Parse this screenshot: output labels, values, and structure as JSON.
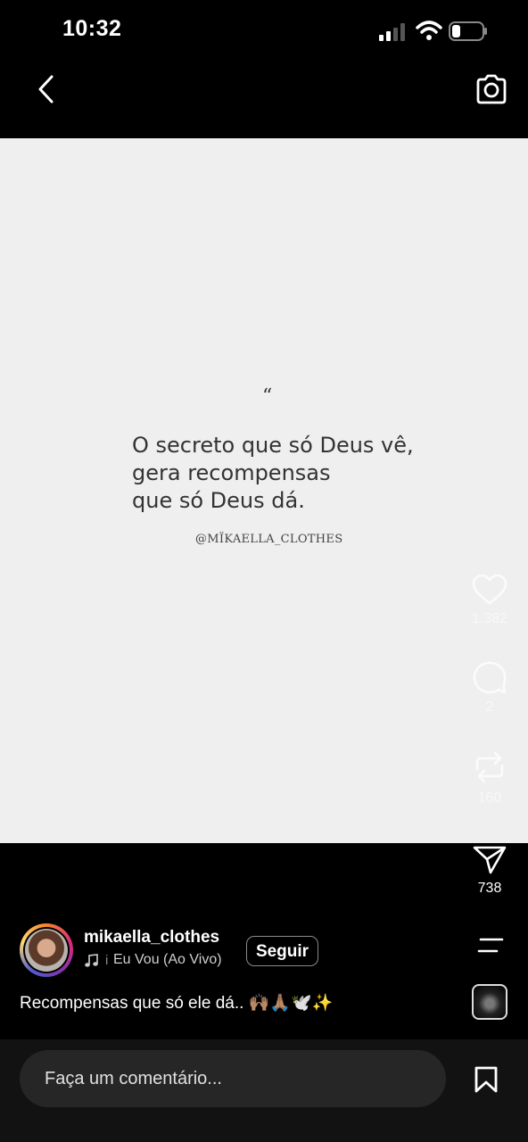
{
  "status_bar": {
    "time": "10:32"
  },
  "post": {
    "quote_mark": "“",
    "quote_lines": [
      "O secreto que só Deus vê,",
      "gera recompensas",
      "que só Deus dá."
    ],
    "signature": "@MÏKAELLA_CLOTHES"
  },
  "actions": {
    "likes": "1.382",
    "comments": "2",
    "reposts": "160",
    "shares": "738"
  },
  "user": {
    "username": "mikaella_clothes",
    "music_separator": "i",
    "music": "Eu Vou (Ao Vivo)",
    "follow_label": "Seguir"
  },
  "caption": "Recompensas que só ele dá.. 🙌🏽🙏🏽🕊️✨",
  "comment_placeholder": "Faça um comentário...",
  "colors": {
    "background": "#000000",
    "content": "#efefef",
    "comment_box": "#262626"
  },
  "icons": [
    "back-icon",
    "camera-icon",
    "heart-icon",
    "comment-icon",
    "repost-icon",
    "send-icon",
    "menu-icon",
    "music-note-icon",
    "bookmark-icon"
  ]
}
